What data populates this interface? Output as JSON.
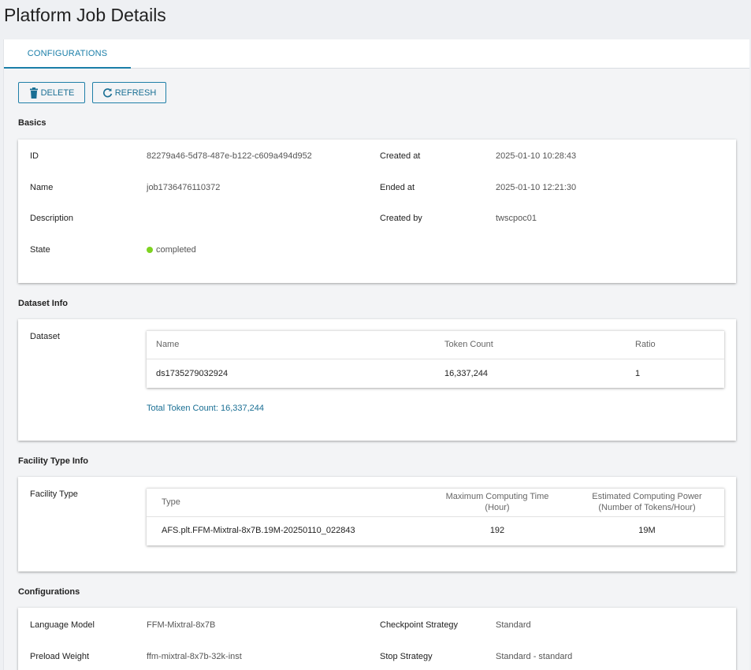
{
  "page_title": "Platform Job Details",
  "tabs": [
    {
      "label": "CONFIGURATIONS"
    }
  ],
  "toolbar": {
    "delete_label": "DELETE",
    "refresh_label": "REFRESH"
  },
  "basics": {
    "title": "Basics",
    "id_label": "ID",
    "id_value": "82279a46-5d78-487e-b122-c609a494d952",
    "name_label": "Name",
    "name_value": "job1736476110372",
    "description_label": "Description",
    "description_value": "",
    "state_label": "State",
    "state_value": "completed",
    "created_at_label": "Created at",
    "created_at_value": "2025-01-10 10:28:43",
    "ended_at_label": "Ended at",
    "ended_at_value": "2025-01-10 12:21:30",
    "created_by_label": "Created by",
    "created_by_value": "twscpoc01",
    "state_color": "#7ed321"
  },
  "dataset": {
    "title": "Dataset Info",
    "label": "Dataset",
    "columns": [
      "Name",
      "Token Count",
      "Ratio"
    ],
    "rows": [
      [
        "ds1735279032924",
        "16,337,244",
        "1"
      ]
    ],
    "total": "Total Token Count: 16,337,244"
  },
  "facility": {
    "title": "Facility Type Info",
    "label": "Facility Type",
    "columns": {
      "type": "Type",
      "max_time_line1": "Maximum Computing Time",
      "max_time_line2": "(Hour)",
      "power_line1": "Estimated Computing Power",
      "power_line2": "(Number of Tokens/Hour)"
    },
    "rows": [
      [
        "AFS.plt.FFM-Mixtral-8x7B.19M-20250110_022843",
        "192",
        "19M"
      ]
    ]
  },
  "configurations": {
    "title": "Configurations",
    "language_model_label": "Language Model",
    "language_model_value": "FFM-Mixtral-8x7B",
    "preload_weight_label": "Preload Weight",
    "preload_weight_value": "ffm-mixtral-8x7b-32k-inst",
    "checkpoint_strategy_label": "Checkpoint Strategy",
    "checkpoint_strategy_value": "Standard",
    "stop_strategy_label": "Stop Strategy",
    "stop_strategy_value": "Standard - standard"
  },
  "colors": {
    "accent": "#1a7ea8",
    "background": "#eef0f3"
  },
  "icons": {
    "delete": "trash-icon",
    "refresh": "refresh-icon"
  }
}
